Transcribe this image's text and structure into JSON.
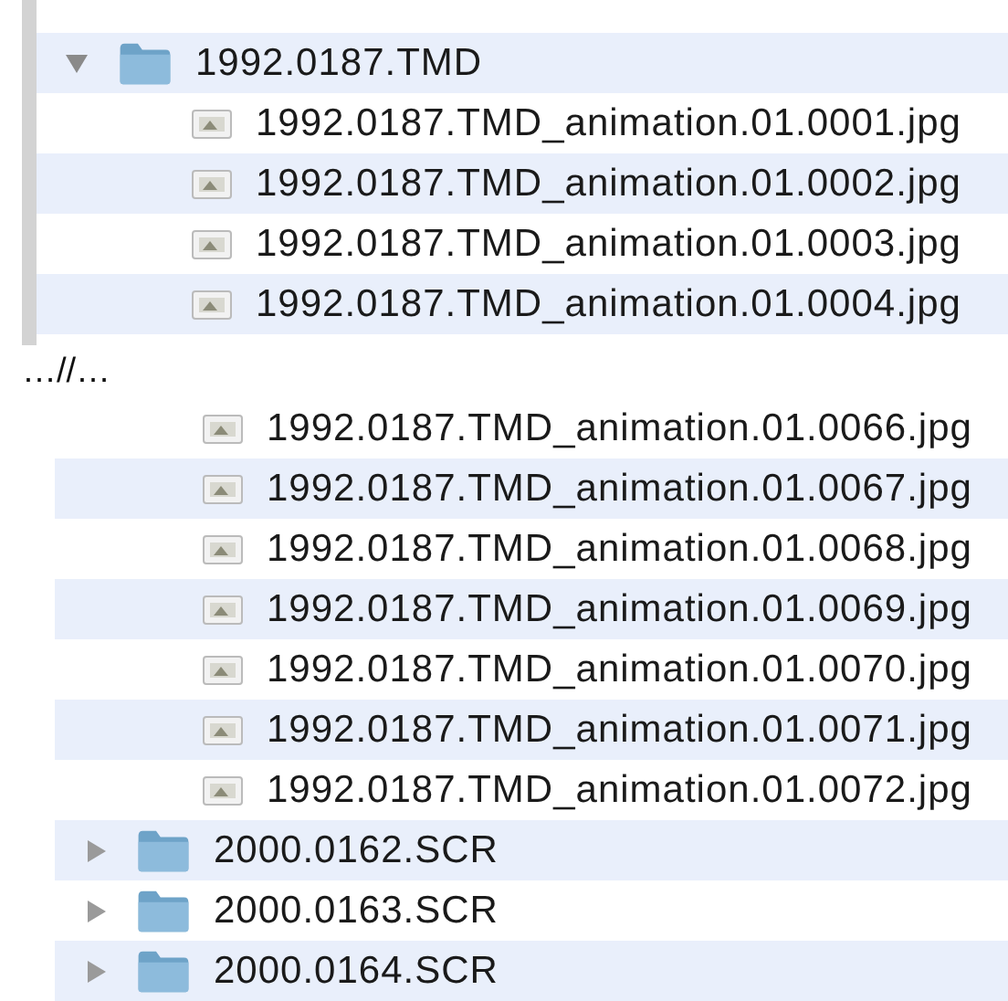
{
  "panels": [
    {
      "kind": "framed",
      "rows": [
        {
          "kind": "folder",
          "name": "1992.0187.TMD",
          "expanded": true,
          "children": [
            {
              "kind": "file",
              "name": "1992.0187.TMD_animation.01.0001.jpg"
            },
            {
              "kind": "file",
              "name": "1992.0187.TMD_animation.01.0002.jpg"
            },
            {
              "kind": "file",
              "name": "1992.0187.TMD_animation.01.0003.jpg"
            },
            {
              "kind": "file",
              "name": "1992.0187.TMD_animation.01.0004.jpg"
            }
          ]
        }
      ]
    },
    {
      "kind": "separator",
      "text": "…//…"
    },
    {
      "kind": "plain",
      "rows": [
        {
          "kind": "file",
          "name": "1992.0187.TMD_animation.01.0066.jpg"
        },
        {
          "kind": "file",
          "name": "1992.0187.TMD_animation.01.0067.jpg"
        },
        {
          "kind": "file",
          "name": "1992.0187.TMD_animation.01.0068.jpg"
        },
        {
          "kind": "file",
          "name": "1992.0187.TMD_animation.01.0069.jpg"
        },
        {
          "kind": "file",
          "name": "1992.0187.TMD_animation.01.0070.jpg"
        },
        {
          "kind": "file",
          "name": "1992.0187.TMD_animation.01.0071.jpg"
        },
        {
          "kind": "file",
          "name": "1992.0187.TMD_animation.01.0072.jpg"
        },
        {
          "kind": "folder",
          "name": "2000.0162.SCR",
          "expanded": false
        },
        {
          "kind": "folder",
          "name": "2000.0163.SCR",
          "expanded": false
        },
        {
          "kind": "folder",
          "name": "2000.0164.SCR",
          "expanded": false
        }
      ]
    }
  ]
}
